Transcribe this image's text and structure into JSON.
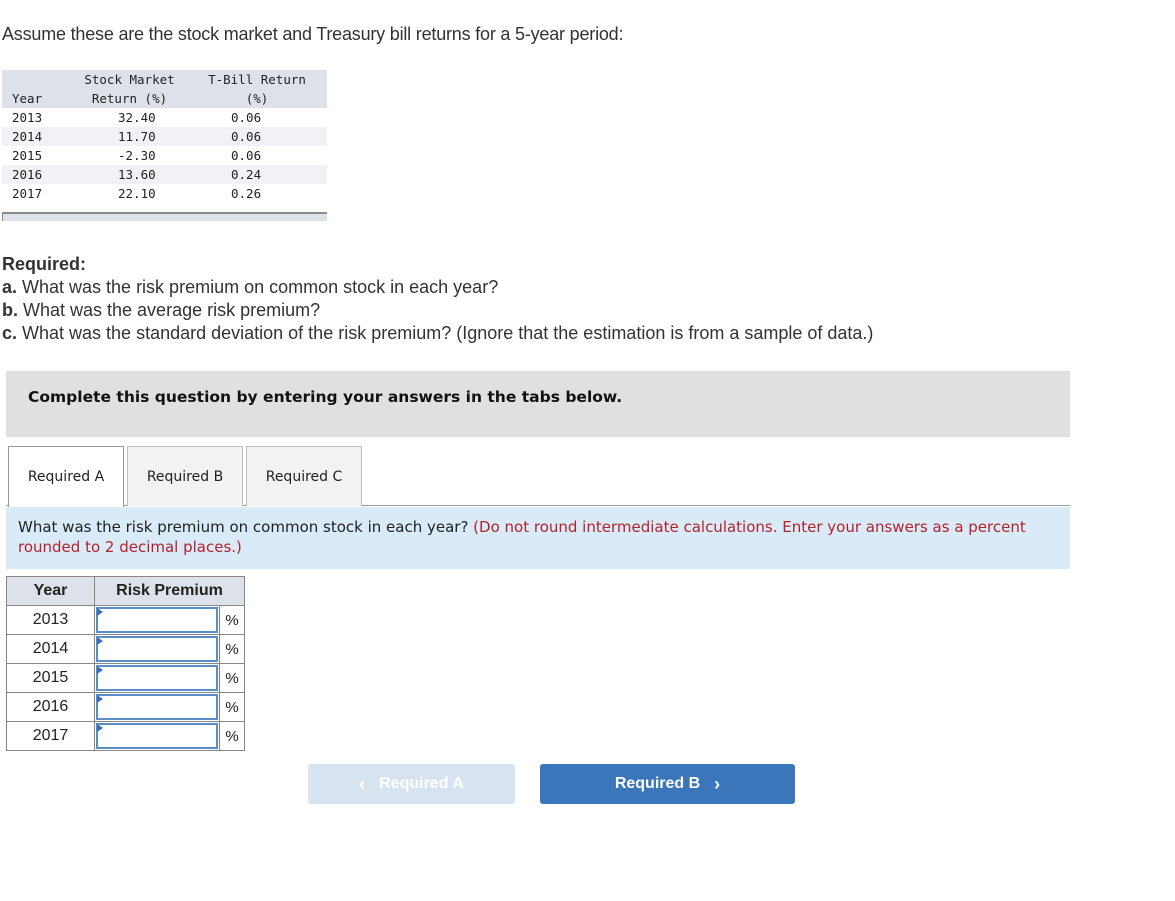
{
  "intro": "Assume these are the stock market and Treasury bill returns for a 5-year period:",
  "returns_table": {
    "headers": {
      "year": "Year",
      "stock_line1": "Stock Market",
      "stock_line2": "Return (%)",
      "tbill_line1": "T-Bill Return",
      "tbill_line2": "(%)"
    },
    "rows": [
      {
        "year": "2013",
        "stock": "32.40",
        "tbill": "0.06"
      },
      {
        "year": "2014",
        "stock": "11.70",
        "tbill": "0.06"
      },
      {
        "year": "2015",
        "stock": "-2.30",
        "tbill": "0.06"
      },
      {
        "year": "2016",
        "stock": "13.60",
        "tbill": "0.24"
      },
      {
        "year": "2017",
        "stock": "22.10",
        "tbill": "0.26"
      }
    ]
  },
  "required": {
    "heading": "Required:",
    "items": [
      {
        "label": "a.",
        "text": " What was the risk premium on common stock in each year?"
      },
      {
        "label": "b.",
        "text": " What was the average risk premium?"
      },
      {
        "label": "c.",
        "text": " What was the standard deviation of the risk premium? (Ignore that the estimation is from a sample of data.)"
      }
    ]
  },
  "instructions": "Complete this question by entering your answers in the tabs below.",
  "tabs": [
    {
      "label": "Required A",
      "active": true
    },
    {
      "label": "Required B",
      "active": false
    },
    {
      "label": "Required C",
      "active": false
    }
  ],
  "question": {
    "text": "What was the risk premium on common stock in each year? ",
    "note": "(Do not round intermediate calculations. Enter your answers as a percent rounded to 2 decimal places.)"
  },
  "answer_table": {
    "headers": {
      "year": "Year",
      "premium": "Risk Premium"
    },
    "unit": "%",
    "rows": [
      {
        "year": "2013",
        "value": ""
      },
      {
        "year": "2014",
        "value": ""
      },
      {
        "year": "2015",
        "value": ""
      },
      {
        "year": "2016",
        "value": ""
      },
      {
        "year": "2017",
        "value": ""
      }
    ]
  },
  "navigation": {
    "prev_label": "Required A",
    "next_label": "Required B",
    "prev_icon": "chevron-left",
    "next_icon": "chevron-right"
  },
  "colors": {
    "accent": "#3a76b9",
    "disabled": "#d8e3f0",
    "note_red": "#b5222b",
    "question_bg": "#d9ebf8",
    "instruction_bg": "#e0e0e0"
  }
}
